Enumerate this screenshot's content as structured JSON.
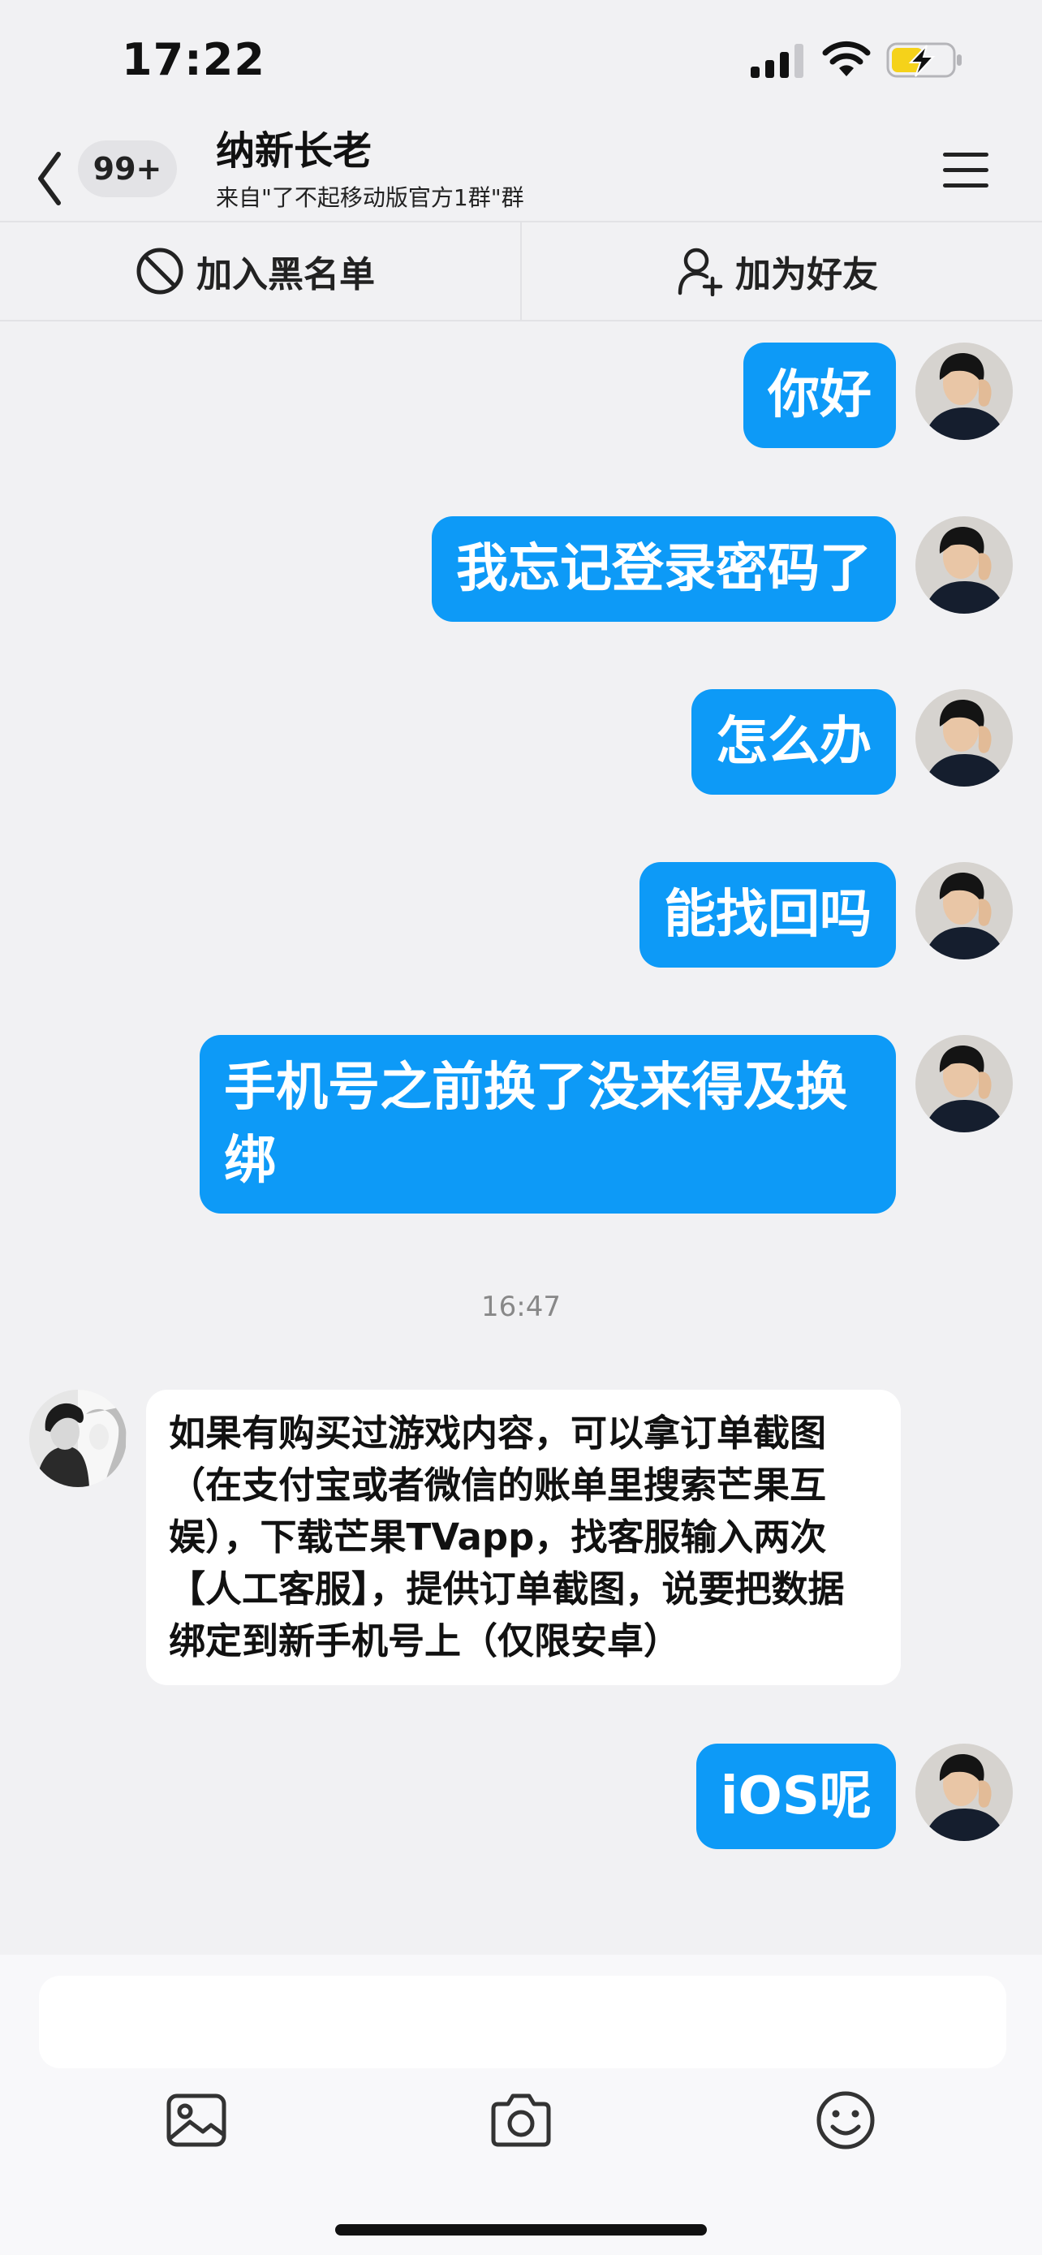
{
  "status_bar": {
    "time": "17:22"
  },
  "header": {
    "unread_badge": "99+",
    "title": "纳新长老",
    "subtitle": "来自\"了不起移动版官方1群\"群"
  },
  "actions": {
    "blacklist_label": "加入黑名单",
    "add_friend_label": "加为好友"
  },
  "messages": {
    "outgoing_1": "你好",
    "outgoing_2": "我忘记登录密码了",
    "outgoing_3": "怎么办",
    "outgoing_4": "能找回吗",
    "outgoing_5": "手机号之前换了没来得及换绑",
    "timestamp": "16:47",
    "incoming_1": "如果有购买过游戏内容，可以拿订单截图（在支付宝或者微信的账单里搜索芒果互娱），下载芒果TVapp，找客服输入两次【人工客服】，提供订单截图，说要把数据绑定到新手机号上（仅限安卓）",
    "outgoing_6": "iOS呢"
  },
  "colors": {
    "outgoing_bubble": "#0d9af7",
    "incoming_bubble": "#ffffff",
    "background": "#f1f1f3",
    "battery_charge": "#f5d21a"
  },
  "icons": [
    "signal-icon",
    "wifi-icon",
    "battery-charging-icon",
    "back-chevron-icon",
    "menu-icon",
    "block-icon",
    "add-user-icon",
    "image-icon",
    "camera-icon",
    "emoji-icon"
  ]
}
